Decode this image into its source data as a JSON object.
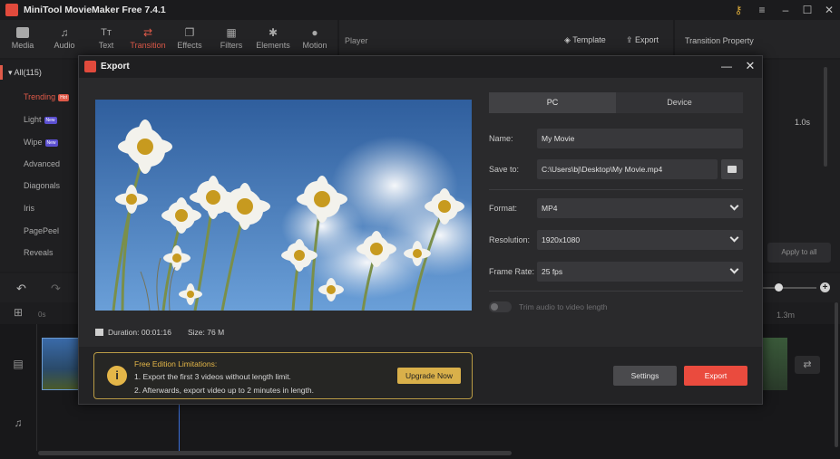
{
  "app": {
    "title": "MiniTool MovieMaker Free 7.4.1"
  },
  "toolbar": {
    "items": [
      {
        "label": "Media"
      },
      {
        "label": "Audio"
      },
      {
        "label": "Text"
      },
      {
        "label": "Transition"
      },
      {
        "label": "Effects"
      },
      {
        "label": "Filters"
      },
      {
        "label": "Elements"
      },
      {
        "label": "Motion"
      }
    ]
  },
  "player": {
    "label": "Player",
    "template_label": "Template",
    "export_label": "Export"
  },
  "properties": {
    "label": "Transition Property",
    "duration": "1.0s",
    "apply_label": "Apply to all"
  },
  "library": {
    "all_label": "All(115)",
    "categories": [
      {
        "label": "Trending",
        "badge": "Hot"
      },
      {
        "label": "Light",
        "badge": "New"
      },
      {
        "label": "Wipe",
        "badge": "New"
      },
      {
        "label": "Advanced"
      },
      {
        "label": "Diagonals"
      },
      {
        "label": "Iris"
      },
      {
        "label": "PagePeel"
      },
      {
        "label": "Reveals"
      }
    ]
  },
  "timeline": {
    "start": "0s",
    "mark": "1.3m"
  },
  "dialog": {
    "title": "Export",
    "tabs": {
      "pc": "PC",
      "device": "Device"
    },
    "name_label": "Name:",
    "name_value": "My Movie",
    "save_label": "Save to:",
    "save_value": "C:\\Users\\bj\\Desktop\\My Movie.mp4",
    "format_label": "Format:",
    "format_value": "MP4",
    "resolution_label": "Resolution:",
    "resolution_value": "1920x1080",
    "framerate_label": "Frame Rate:",
    "framerate_value": "25 fps",
    "trim_label": "Trim audio to video length",
    "duration_text": "Duration:  00:01:16",
    "size_text": "Size:  76 M",
    "limits_title": "Free Edition Limitations:",
    "limits_line1": "1. Export the first 3 videos without length limit.",
    "limits_line2": "2. Afterwards, export video up to 2 minutes in length.",
    "upgrade_label": "Upgrade Now",
    "settings_label": "Settings",
    "export_label": "Export"
  },
  "colors": {
    "accent": "#e05a49",
    "export": "#ea4b3e",
    "upgrade": "#d9b04a"
  }
}
